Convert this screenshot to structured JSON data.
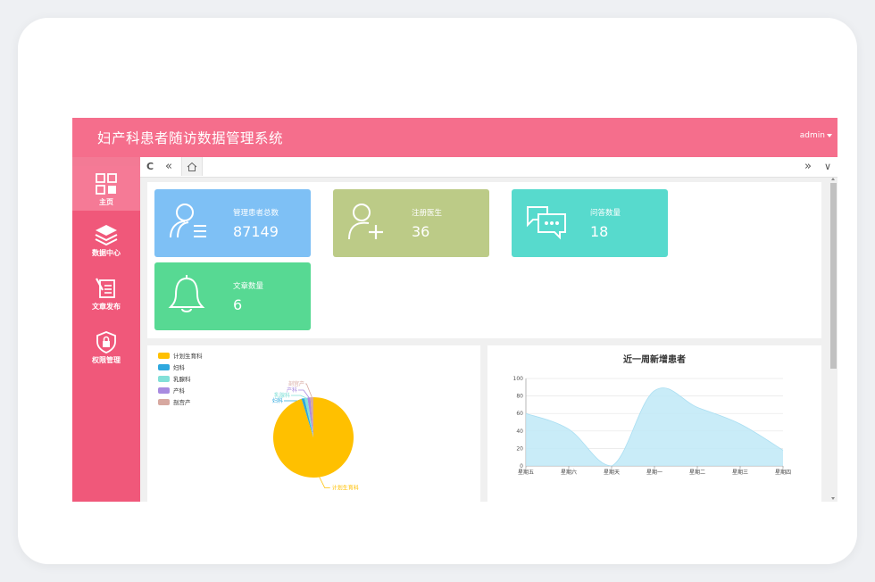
{
  "app": {
    "title": "妇产科患者随访数据管理系统",
    "user": "admin"
  },
  "colors": {
    "topbar": "#f56e8c",
    "sidebar": "#f0587a",
    "sidebar_active": "#f57a96"
  },
  "sidebar": {
    "items": [
      {
        "label": "主页",
        "icon": "grid-icon"
      },
      {
        "label": "数据中心",
        "icon": "layers-icon"
      },
      {
        "label": "文章发布",
        "icon": "document-pen-icon"
      },
      {
        "label": "权限管理",
        "icon": "shield-lock-icon"
      }
    ]
  },
  "tabs": {
    "refresh": "C",
    "prev": "«",
    "next": "»",
    "menu": "∨",
    "home_icon": "home-icon"
  },
  "stats": [
    {
      "label": "管理患者总数",
      "value": "87149",
      "color": "#7ec0f5",
      "icon": "patients-list-icon"
    },
    {
      "label": "注册医生",
      "value": "36",
      "color": "#bccb87",
      "icon": "user-add-icon"
    },
    {
      "label": "问答数量",
      "value": "18",
      "color": "#57dacd",
      "icon": "chat-bubbles-icon"
    },
    {
      "label": "文章数量",
      "value": "6",
      "color": "#57d993",
      "icon": "bell-icon"
    }
  ],
  "chart_data": [
    {
      "type": "pie",
      "legend": [
        "计划生育科",
        "妇科",
        "乳腺科",
        "产科",
        "剖宫产"
      ],
      "legend_position": "top-left",
      "values": [
        87000,
        30,
        40,
        35,
        44
      ],
      "colors": [
        "#ffc000",
        "#2ea8de",
        "#82e0d8",
        "#a88be0",
        "#d7a8a0"
      ]
    },
    {
      "type": "area",
      "title": "近一周新增患者",
      "categories": [
        "星期五",
        "星期六",
        "星期天",
        "星期一",
        "星期二",
        "星期三",
        "星期四"
      ],
      "values": [
        60,
        42,
        0,
        86,
        67,
        48,
        18
      ],
      "ylim": [
        0,
        100
      ],
      "yticks": [
        0,
        20,
        40,
        60,
        80,
        100
      ],
      "grid": true,
      "color": "#bfe9f7"
    }
  ]
}
